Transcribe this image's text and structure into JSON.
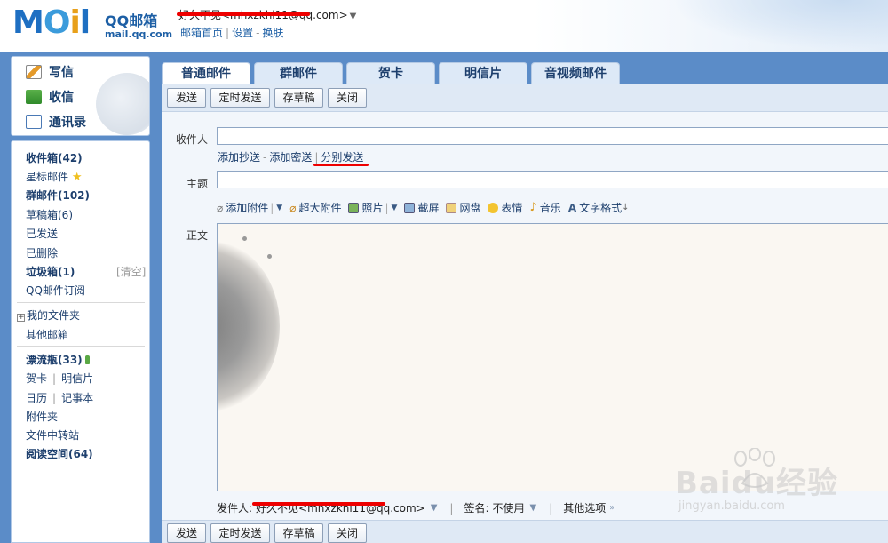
{
  "header": {
    "logo_text": "MOil",
    "brand": "QQ邮箱",
    "brand_url": "mail.qq.com",
    "account": "好久不见<mhxzkhl11@qq.com>",
    "links": [
      "邮箱首页",
      "设置",
      "换肤"
    ]
  },
  "quick": {
    "compose": "写信",
    "inbox": "收信",
    "contacts": "通讯录"
  },
  "folders": {
    "inbox": "收件箱(42)",
    "starred": "星标邮件",
    "group": "群邮件(102)",
    "drafts": "草稿箱(6)",
    "sent": "已发送",
    "deleted": "已删除",
    "spam": "垃圾箱(1)",
    "spam_clear": "[清空]",
    "subscribe": "QQ邮件订阅",
    "myfolders": "我的文件夹",
    "other": "其他邮箱",
    "drift": "漂流瓶(33)",
    "card": "贺卡",
    "postcard": "明信片",
    "calendar": "日历",
    "notes": "记事本",
    "attachments": "附件夹",
    "transfer": "文件中转站",
    "reading": "阅读空间(64)"
  },
  "tabs": [
    "普通邮件",
    "群邮件",
    "贺卡",
    "明信片",
    "音视频邮件"
  ],
  "toolbar": {
    "send": "发送",
    "scheduled": "定时发送",
    "save_draft": "存草稿",
    "close": "关闭"
  },
  "compose": {
    "to_label": "收件人",
    "to_value": "",
    "add_cc": "添加抄送",
    "add_bcc": "添加密送",
    "separate": "分别发送",
    "subject_label": "主题",
    "subject_value": "",
    "body_label": "正文",
    "tools": {
      "attach": "添加附件",
      "big_attach": "超大附件",
      "photo": "照片",
      "screenshot": "截屏",
      "disk": "网盘",
      "emoji": "表情",
      "music": "音乐",
      "format": "文字格式"
    },
    "sender_label": "发件人:",
    "sender_value": "好久不见<mhxzkhl11@qq.com>",
    "signature_label": "签名:",
    "signature_value": "不使用",
    "more_options": "其他选项"
  },
  "watermark": {
    "text": "Baidu经验",
    "url": "jingyan.baidu.com"
  }
}
